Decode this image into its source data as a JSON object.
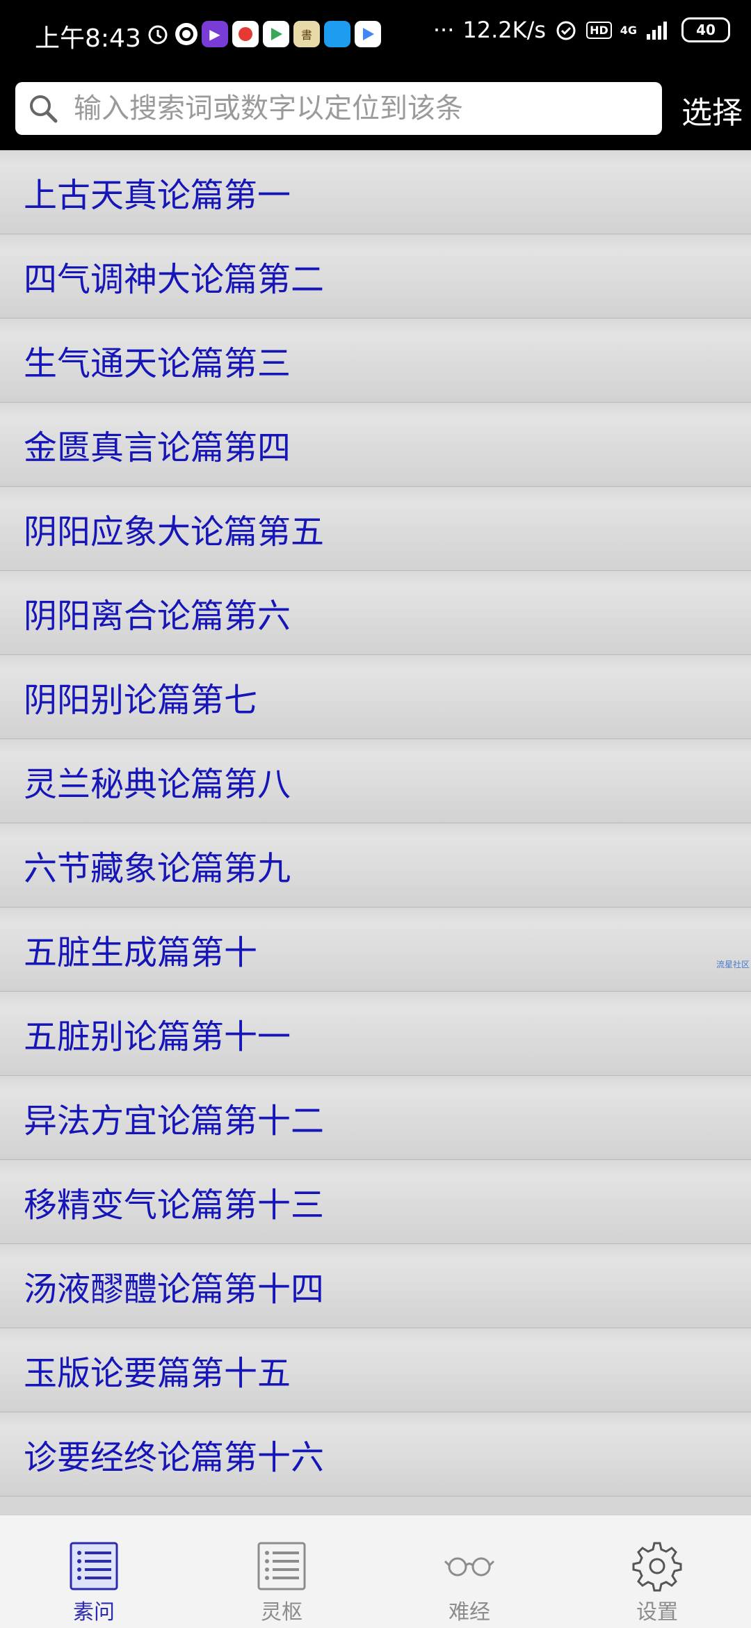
{
  "status_bar": {
    "time": "上午8:43",
    "net_speed": "12.2K/s",
    "network": "4G",
    "battery": "40",
    "more": "···",
    "hd": "HD",
    "app_icons": [
      "alarm-icon",
      "q-app-icon",
      "video-app-icon",
      "red-app-icon",
      "play-app-icon",
      "book-app-icon",
      "blue-app-icon",
      "play-app-icon-2"
    ]
  },
  "search": {
    "placeholder": "输入搜索词或数字以定位到该条",
    "value": ""
  },
  "header": {
    "select_label": "选择"
  },
  "list": {
    "items": [
      "上古天真论篇第一",
      "四气调神大论篇第二",
      "生气通天论篇第三",
      "金匮真言论篇第四",
      "阴阳应象大论篇第五",
      "阴阳离合论篇第六",
      "阴阳别论篇第七",
      "灵兰秘典论篇第八",
      "六节藏象论篇第九",
      "五脏生成篇第十",
      "五脏别论篇第十一",
      "异法方宜论篇第十二",
      "移精变气论篇第十三",
      "汤液醪醴论篇第十四",
      "玉版论要篇第十五",
      "诊要经终论篇第十六"
    ]
  },
  "watermark": "流星社区",
  "tabs": [
    {
      "label": "素问",
      "icon": "list-icon",
      "active": true
    },
    {
      "label": "灵枢",
      "icon": "list-icon",
      "active": false
    },
    {
      "label": "难经",
      "icon": "glasses-icon",
      "active": false
    },
    {
      "label": "设置",
      "icon": "gear-icon",
      "active": false
    }
  ],
  "colors": {
    "item_text": "#1515b8",
    "active_tab": "#2b2bb0",
    "inactive_tab": "#8c8c8c"
  }
}
